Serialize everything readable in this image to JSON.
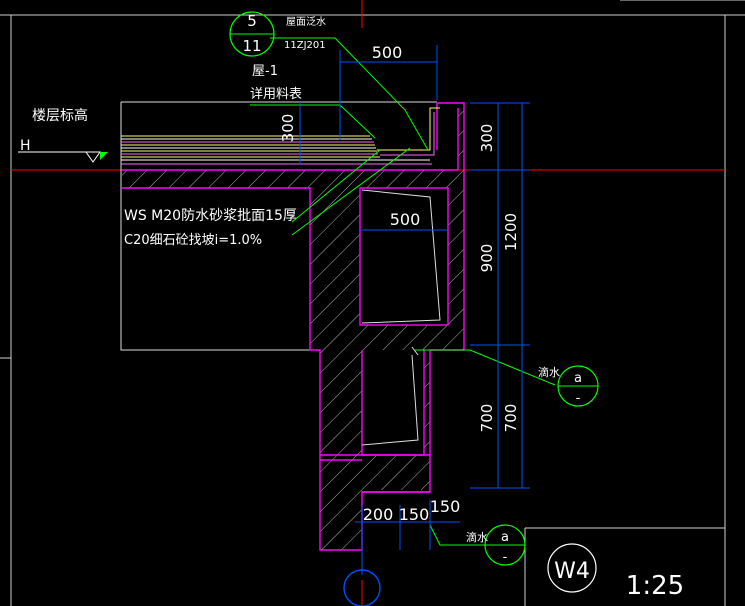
{
  "colors": {
    "background": "#000000",
    "concrete_outline": "#ff00ff",
    "hatch": "#ffffff",
    "dimension": "#0050ff",
    "leader": "#00ff00",
    "level_line": "#ff0000",
    "layers": "#ffff00",
    "frame": "#cfcfcf",
    "text": "#ffffff"
  },
  "detail_ref": {
    "top": "5",
    "bottom": "11",
    "title": "屋面泛水",
    "atlas": "11ZJ201"
  },
  "roof_layers": {
    "line1": "屋-1",
    "line2": "详用料表"
  },
  "floor_level": {
    "label": "楼层标高",
    "symbol": "H"
  },
  "notes": {
    "ws": "WS  M20防水砂浆批面15厚",
    "c20": "C20细石砼找坡i=1.0%"
  },
  "dimensions": {
    "top_width": "500",
    "roof_height": "300",
    "inner_width": "500",
    "right_300": "300",
    "right_900": "900",
    "right_1200": "1200",
    "right_700a": "700",
    "right_700b": "700",
    "bottom_200": "200",
    "bottom_150a": "150",
    "bottom_150b": "150"
  },
  "drip_ref_1": {
    "label": "滴水",
    "top": "a",
    "bottom": "-"
  },
  "drip_ref_2": {
    "label": "滴水",
    "top": "a",
    "bottom": "-"
  },
  "drawing_title": {
    "name": "W4",
    "scale": "1:25"
  }
}
